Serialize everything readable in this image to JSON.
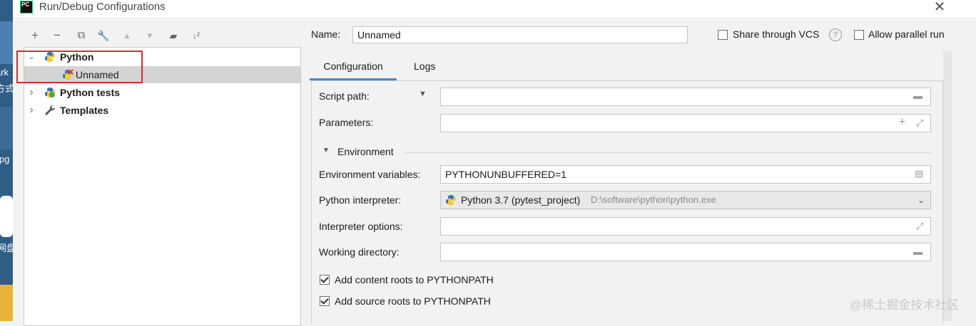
{
  "window": {
    "title": "Run/Debug Configurations",
    "logo_text": "PC"
  },
  "desktop": {
    "labels": [
      "ark",
      "方式",
      "jpg",
      "网盘"
    ]
  },
  "toolbar": {
    "add": "+",
    "remove": "−",
    "copy": "⧉",
    "edit": "🔧",
    "up": "▲",
    "down": "▼",
    "folder": "▰",
    "sort": "↓²"
  },
  "tree": {
    "items": [
      {
        "label": "Python",
        "chevron": "⌄"
      },
      {
        "label": "Unnamed",
        "chevron": ""
      },
      {
        "label": "Python tests",
        "chevron": "›"
      },
      {
        "label": "Templates",
        "chevron": "›"
      }
    ]
  },
  "header": {
    "name_label": "Name:",
    "name_value": "Unnamed",
    "share_label": "Share through VCS",
    "help": "?",
    "parallel_label": "Allow parallel run"
  },
  "tabs": [
    "Configuration",
    "Logs"
  ],
  "form": {
    "script_path_label": "Script path:",
    "script_path_value": "",
    "parameters_label": "Parameters:",
    "parameters_value": "",
    "environment_section": "Environment",
    "env_vars_label": "Environment variables:",
    "env_vars_value": "PYTHONUNBUFFERED=1",
    "interpreter_label": "Python interpreter:",
    "interpreter_value": "Python 3.7 (pytest_project)",
    "interpreter_path": "D:\\software\\python\\python.exe",
    "interp_options_label": "Interpreter options:",
    "interp_options_value": "",
    "working_dir_label": "Working directory:",
    "working_dir_value": "",
    "add_content_roots": "Add content roots to PYTHONPATH",
    "add_source_roots": "Add source roots to PYTHONPATH"
  },
  "watermark": "@稀土掘金技术社区",
  "colors": {
    "accent": "#4a88c7",
    "highlight_red": "#e3262f",
    "selection": "#d4d4d4"
  }
}
